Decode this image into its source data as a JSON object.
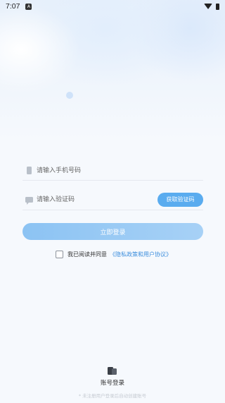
{
  "status_bar": {
    "time": "7:07",
    "app_indicator": "A"
  },
  "form": {
    "phone_placeholder": "请输入手机号码",
    "code_placeholder": "请输入验证码",
    "get_code_label": "获取验证码",
    "login_label": "立即登录"
  },
  "agreement": {
    "checked": false,
    "text": "我已阅读并同意",
    "link": "《隐私政策和用户协议》"
  },
  "alt_login": {
    "label": "账号登录"
  },
  "footer": {
    "note": "* 未注册用户登录后自动创建账号"
  },
  "colors": {
    "accent": "#5aacef",
    "login_button": "#9ccbf5",
    "link": "#3e8fdd"
  }
}
